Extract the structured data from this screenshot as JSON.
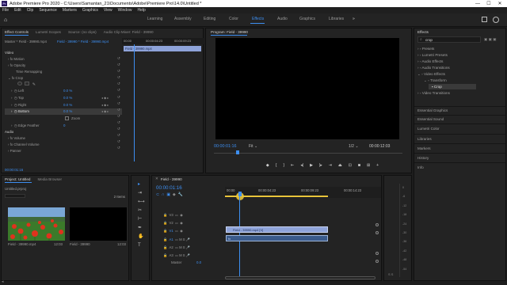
{
  "title_bar": {
    "logo": "Pr",
    "text": "Adobe Premiere Pro 2020 - C:\\Users\\Samantan_21\\Documents\\Adobe\\Premiere Pro\\14.0\\Untitled *",
    "minimize": "—",
    "maximize": "☐",
    "close": "✕"
  },
  "menu": [
    "File",
    "Edit",
    "Clip",
    "Sequence",
    "Markers",
    "Graphics",
    "View",
    "Window",
    "Help"
  ],
  "workspaces": {
    "home_icon": "home-icon",
    "items": [
      "Learning",
      "Assembly",
      "Editing",
      "Color",
      "Effects",
      "Audio",
      "Graphics",
      "Libraries"
    ],
    "active": "Effects",
    "more": "»"
  },
  "source_panel": {
    "tabs": [
      "Effect Controls",
      "Lumetri Scopes",
      "Source: (no clips)",
      "Audio Clip Mixer: Field - 39990"
    ],
    "master_label": "Master * Field - 39990.mp4",
    "sequence_label": "Field - 39990 * Field - 39990.mp4",
    "ruler": [
      "00:00",
      "00:00:04:23",
      "00:00:09:23"
    ],
    "clip_bar": "Field - 39990.mp4",
    "video_header": "Video",
    "motion": "Motion",
    "opacity": "Opacity",
    "time_remapping": "Time Remapping",
    "crop": "Crop",
    "crop_params": [
      {
        "name": "Left",
        "value": "0.0 %"
      },
      {
        "name": "Top",
        "value": "0.0 %"
      },
      {
        "name": "Right",
        "value": "0.0 %"
      },
      {
        "name": "Bottom",
        "value": "0.0 %"
      }
    ],
    "zoom": "Zoom",
    "edge_feather": "Edge Feather",
    "edge_feather_value": "0",
    "audio_header": "Audio",
    "volume": "Volume",
    "channel_volume": "Channel Volume",
    "panner": "Panner",
    "timecode": "00:00:01:16"
  },
  "program_monitor": {
    "title": "Program: Field - 39990",
    "timecode_left": "00:00:01:16",
    "fit": "Fit",
    "fraction": "1/2",
    "timecode_right": "00:00:12:03"
  },
  "effects_panel": {
    "title": "Effects",
    "search_value": "crop",
    "tree": [
      {
        "label": "Presets",
        "indent": 0
      },
      {
        "label": "Lumetri Presets",
        "indent": 0
      },
      {
        "label": "Audio Effects",
        "indent": 0
      },
      {
        "label": "Audio Transitions",
        "indent": 0
      },
      {
        "label": "Video Effects",
        "indent": 0
      },
      {
        "label": "Transform",
        "indent": 1
      },
      {
        "label": "Crop",
        "indent": 2
      },
      {
        "label": "Video Transitions",
        "indent": 0
      }
    ],
    "sections": [
      "Essential Graphics",
      "Essential Sound",
      "Lumetri Color",
      "Libraries",
      "Markers",
      "History",
      "Info"
    ]
  },
  "project_panel": {
    "tabs": [
      "Project: Untitled",
      "Media Browser"
    ],
    "file": "Untitled.prproj",
    "items_count": "2 Items",
    "items": [
      {
        "name": "Field - 39990.mp4",
        "duration": "12:03"
      },
      {
        "name": "Field - 39990",
        "duration": "12:03"
      }
    ]
  },
  "timeline": {
    "title": "Field - 39990",
    "timecode": "00:00:01:16",
    "ruler": [
      "00:00",
      "00:00:04:23",
      "00:00:09:23",
      "00:00:14:23"
    ],
    "video_tracks": [
      "V3",
      "V2",
      "V1"
    ],
    "audio_tracks": [
      "A1",
      "A2",
      "A3"
    ],
    "master": "Master",
    "master_value": "0.0",
    "clip_video": "Field - 39990.mp4 [V]",
    "clip_audio": "fx"
  },
  "meter": {
    "labels": [
      "0",
      "-6",
      "-12",
      "-18",
      "-24",
      "-30",
      "-36",
      "-42",
      "-48",
      "-54"
    ],
    "unit": "dB"
  },
  "colors": {
    "accent": "#3d8ef0",
    "playhead": "#e8c43a",
    "bg": "#1d1d1d"
  }
}
